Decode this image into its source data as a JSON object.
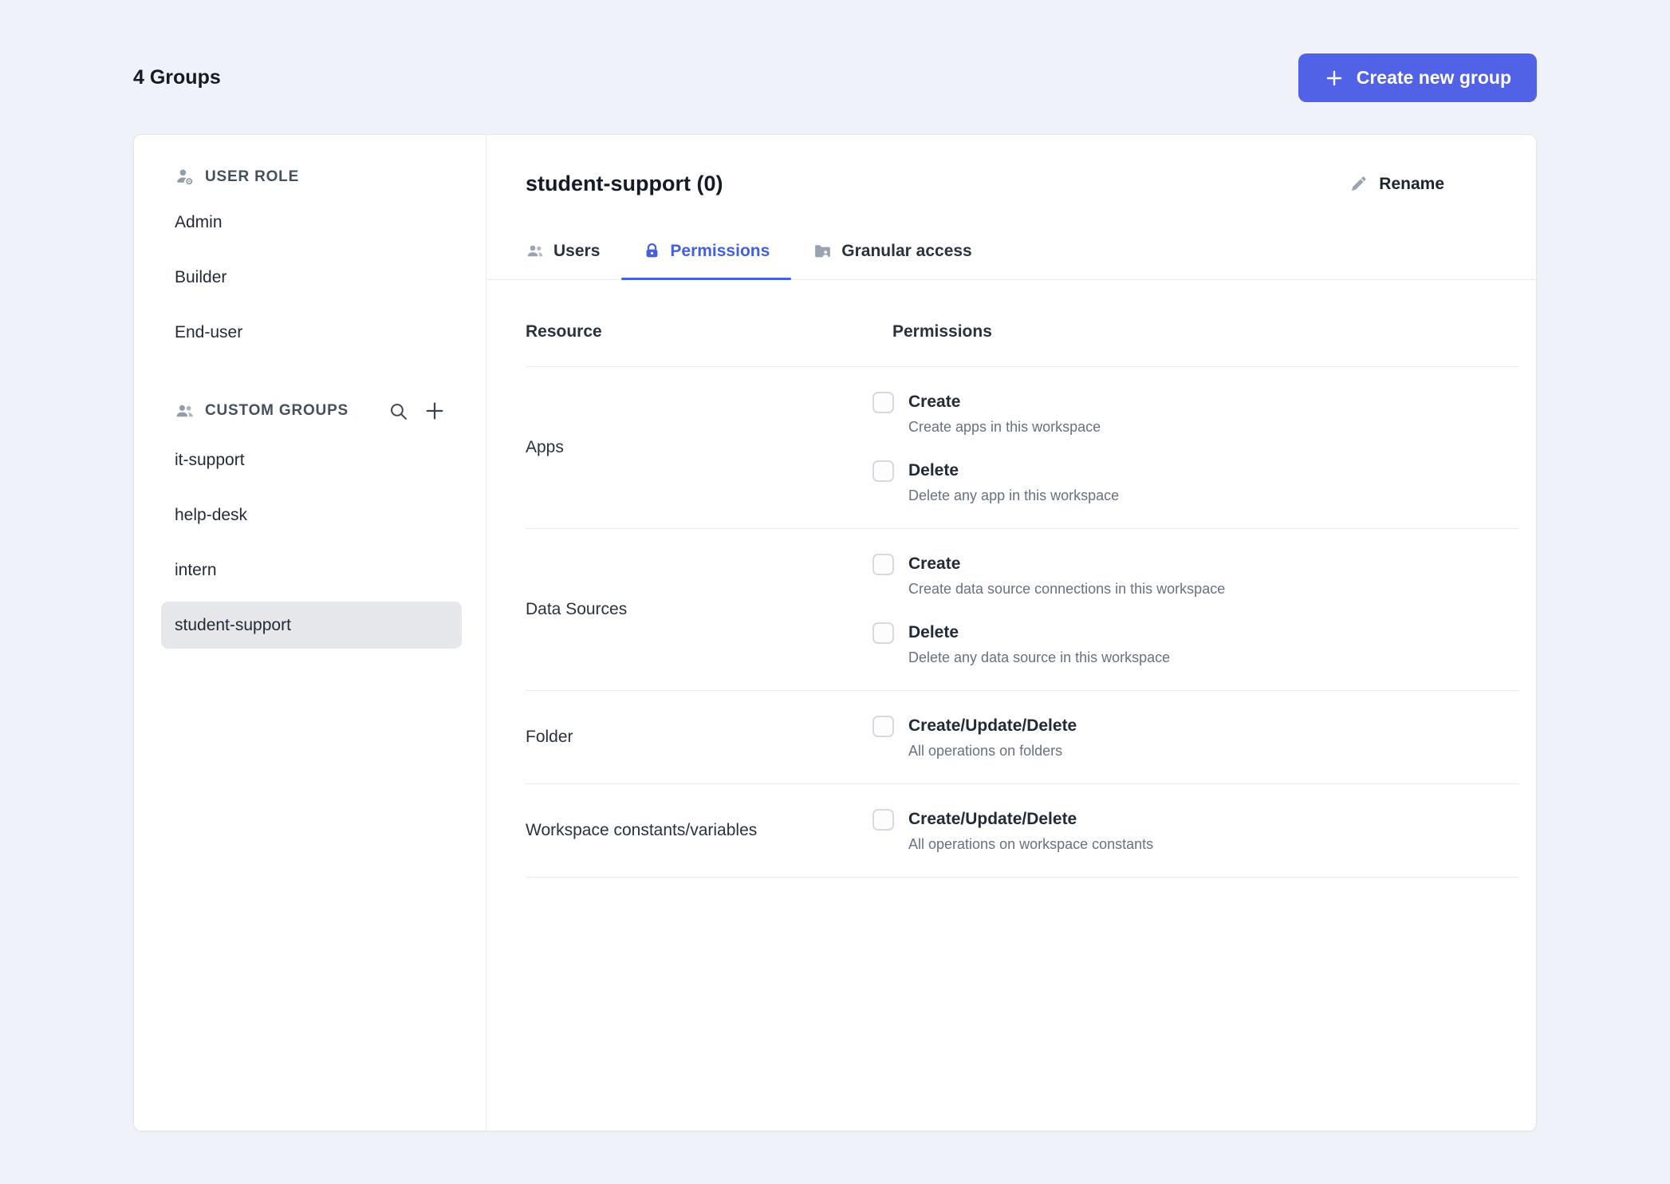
{
  "header": {
    "title": "4 Groups",
    "create_button_label": "Create new group"
  },
  "sidebar": {
    "user_role_header": "USER ROLE",
    "user_roles": [
      "Admin",
      "Builder",
      "End-user"
    ],
    "custom_groups_header": "CUSTOM GROUPS",
    "custom_groups": [
      "it-support",
      "help-desk",
      "intern",
      "student-support"
    ],
    "selected_group": "student-support"
  },
  "panel": {
    "title": "student-support (0)",
    "rename_label": "Rename",
    "active_tab": "Permissions",
    "tabs": [
      {
        "label": "Users"
      },
      {
        "label": "Permissions"
      },
      {
        "label": "Granular access"
      }
    ],
    "table": {
      "headers": [
        "Resource",
        "Permissions"
      ],
      "rows": [
        {
          "resource": "Apps",
          "permissions": [
            {
              "label": "Create",
              "description": "Create apps in this workspace",
              "checked": false
            },
            {
              "label": "Delete",
              "description": "Delete any app in this workspace",
              "checked": false
            }
          ]
        },
        {
          "resource": "Data Sources",
          "permissions": [
            {
              "label": "Create",
              "description": "Create data source connections in this workspace",
              "checked": false
            },
            {
              "label": "Delete",
              "description": "Delete any data source in this workspace",
              "checked": false
            }
          ]
        },
        {
          "resource": "Folder",
          "permissions": [
            {
              "label": "Create/Update/Delete",
              "description": "All operations on folders",
              "checked": false
            }
          ]
        },
        {
          "resource": "Workspace constants/variables",
          "permissions": [
            {
              "label": "Create/Update/Delete",
              "description": "All operations on workspace constants",
              "checked": false
            }
          ]
        }
      ]
    }
  },
  "icons": {
    "create_group_button": "plus",
    "user_role_section": "person-gear",
    "custom_groups_section": "people",
    "custom_groups_search": "magnifier",
    "custom_groups_add": "plus",
    "tab_users": "people",
    "tab_permissions": "lock",
    "tab_granular_access": "folder",
    "rename": "pencil"
  },
  "colors": {
    "page_background": "#eff3f9",
    "card_background": "#ffffff",
    "accent_blue": "#4361de",
    "create_button_blue": "#5262e6",
    "selected_item_background": "#e5e7ea",
    "divider": "#e9ebee",
    "secondary_text": "#68717f"
  }
}
